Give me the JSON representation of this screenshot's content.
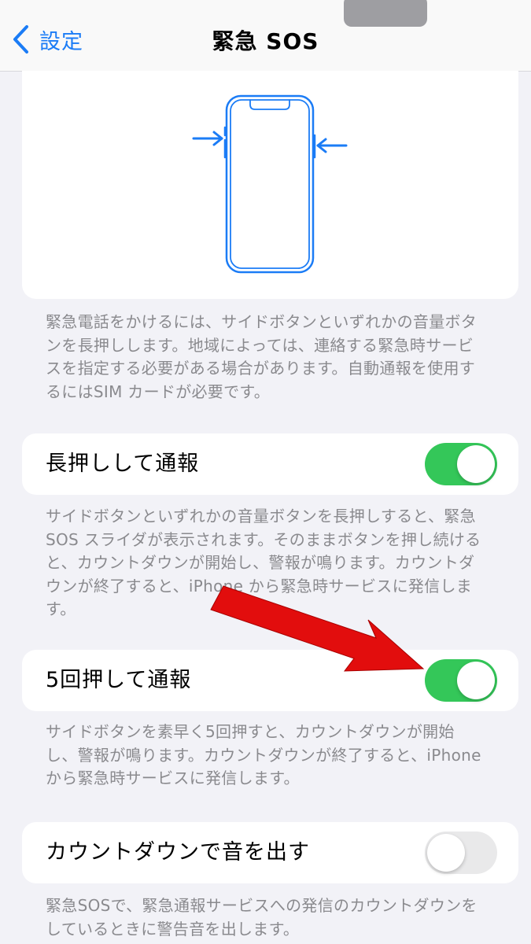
{
  "nav": {
    "back_label": "設定",
    "title": "緊急 SOS"
  },
  "intro": {
    "description": "緊急電話をかけるには、サイドボタンといずれかの音量ボタンを長押しします。地域によっては、連絡する緊急時サービスを指定する必要がある場合があります。自動通報を使用するにはSIM カードが必要です。"
  },
  "settings": [
    {
      "label": "長押しして通報",
      "on": true,
      "footer": "サイドボタンといずれかの音量ボタンを長押しすると、緊急SOS スライダが表示されます。そのままボタンを押し続けると、カウントダウンが開始し、警報が鳴ります。カウントダウンが終了すると、iPhone から緊急時サービスに発信します。"
    },
    {
      "label": "5回押して通報",
      "on": true,
      "footer": "サイドボタンを素早く5回押すと、カウントダウンが開始し、警報が鳴ります。カウントダウンが終了すると、iPhoneから緊急時サービスに発信します。"
    },
    {
      "label": "カウントダウンで音を出す",
      "on": false,
      "footer": "緊急SOSで、緊急通報サービスへの発信のカウントダウンをしているときに警告音を出します。"
    }
  ],
  "colors": {
    "accent": "#1b7cf6",
    "toggle_on": "#34c759",
    "toggle_off": "#e9e9ea",
    "annotation_arrow": "#e20d0d"
  },
  "icons": {
    "back": "chevron-left-icon",
    "illustration": "iphone-side-buttons-diagram",
    "annotation": "red-arrow"
  }
}
